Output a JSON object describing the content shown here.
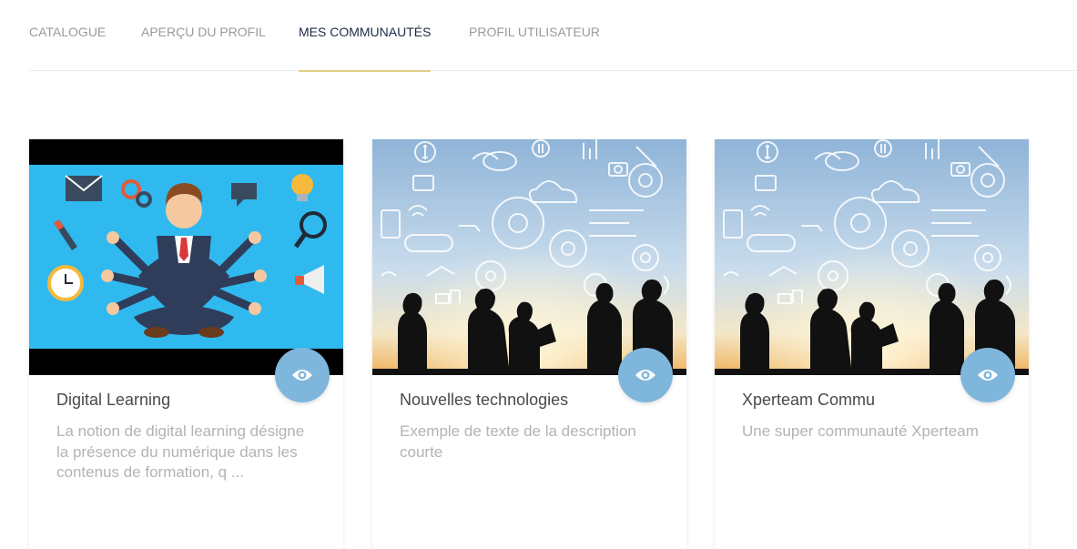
{
  "tabs": [
    {
      "label": "CATALOGUE",
      "active": false
    },
    {
      "label": "APERÇU DU PROFIL",
      "active": false
    },
    {
      "label": "MES COMMUNAUTÉS",
      "active": true
    },
    {
      "label": "PROFIL UTILISATEUR",
      "active": false
    }
  ],
  "colors": {
    "accent_underline": "#e0cf8a",
    "active_tab": "#1e2a45",
    "eye_button": "#7fb6dc"
  },
  "communities": [
    {
      "title": "Digital Learning",
      "description": "La notion de digital learning désigne la présence du numérique dans les contenus de formation, q ...",
      "image": "multitasking-businessman-illustration",
      "action_icon": "eye-icon"
    },
    {
      "title": "Nouvelles technologies",
      "description": "Exemple de texte de la description courte",
      "image": "business-silhouettes-technology-icons",
      "action_icon": "eye-icon"
    },
    {
      "title": "Xperteam Commu",
      "description": "Une super communauté Xperteam",
      "image": "business-silhouettes-technology-icons",
      "action_icon": "eye-icon"
    }
  ]
}
